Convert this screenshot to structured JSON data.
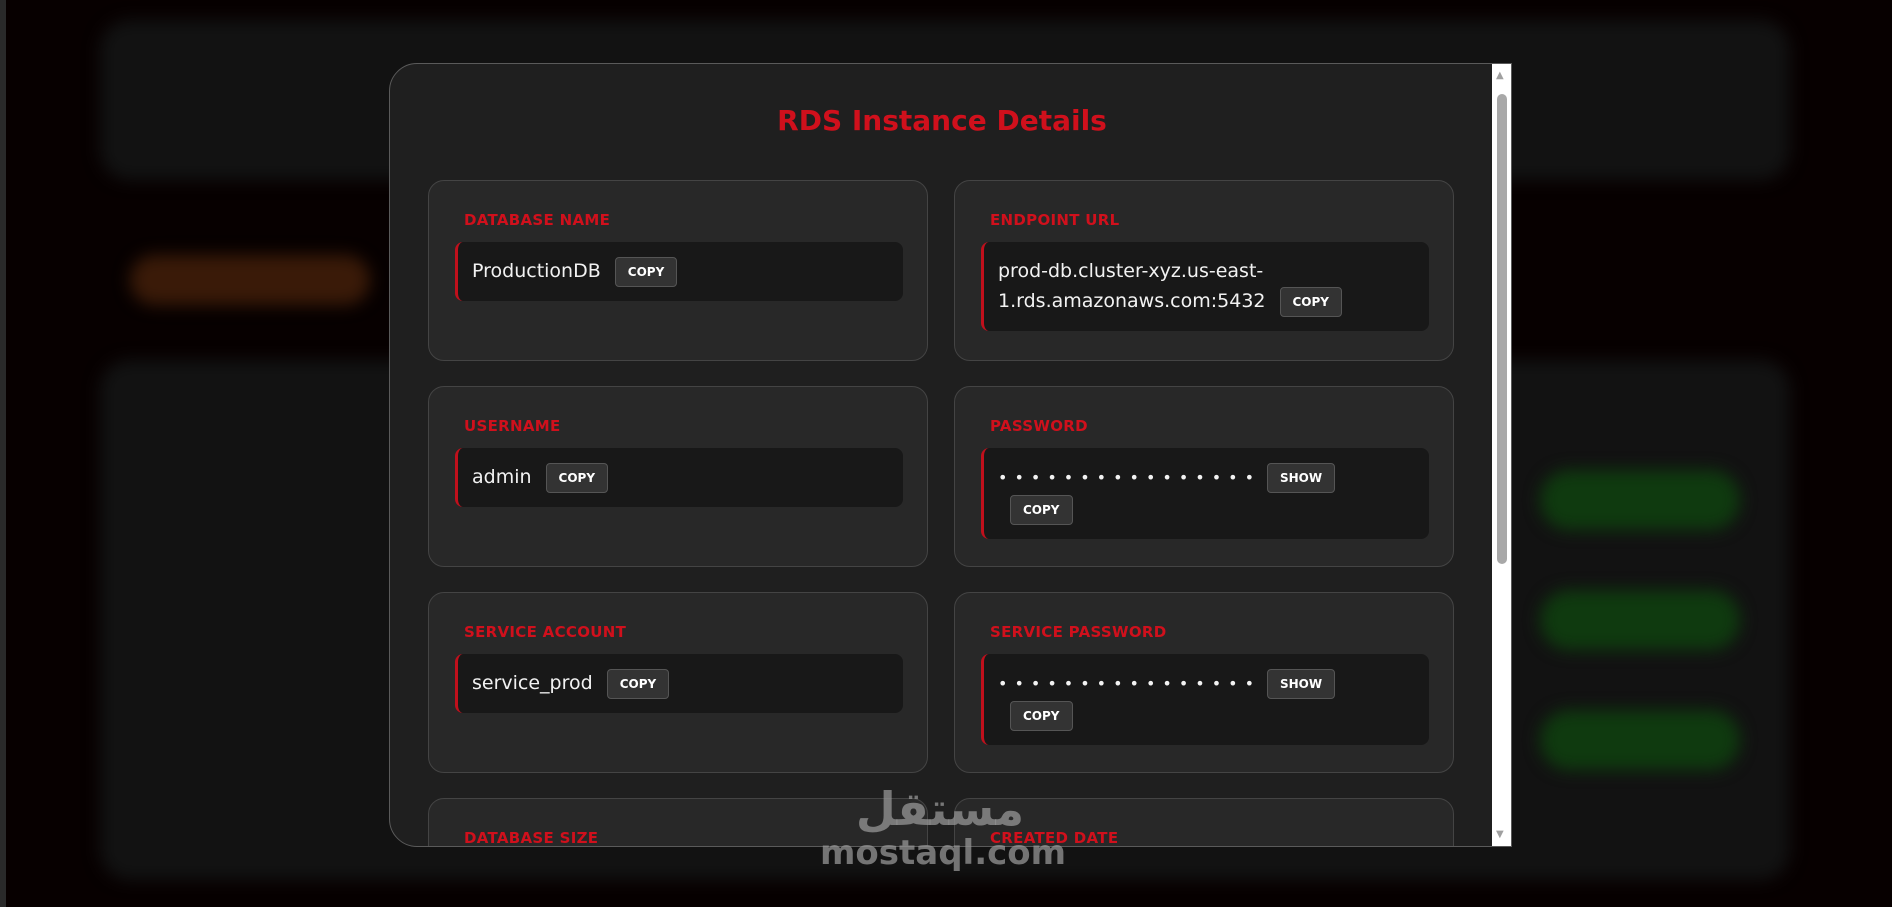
{
  "modal": {
    "title": "RDS Instance Details"
  },
  "fields": [
    {
      "label": "DATABASE NAME",
      "value": "ProductionDB",
      "copy": "COPY"
    },
    {
      "label": "ENDPOINT URL",
      "value": "prod-db.cluster-xyz.us-east-1.rds.amazonaws.com:5432",
      "copy": "COPY"
    },
    {
      "label": "USERNAME",
      "value": "admin",
      "copy": "COPY"
    },
    {
      "label": "PASSWORD",
      "value": "••••••••••••••••",
      "show": "SHOW",
      "copy": "COPY"
    },
    {
      "label": "SERVICE ACCOUNT",
      "value": "service_prod",
      "copy": "COPY"
    },
    {
      "label": "SERVICE PASSWORD",
      "value": "••••••••••••••••",
      "show": "SHOW",
      "copy": "COPY"
    },
    {
      "label": "DATABASE SIZE"
    },
    {
      "label": "CREATED DATE"
    }
  ],
  "watermark": {
    "arabic": "مستقل",
    "latin": "mostaql.com"
  }
}
